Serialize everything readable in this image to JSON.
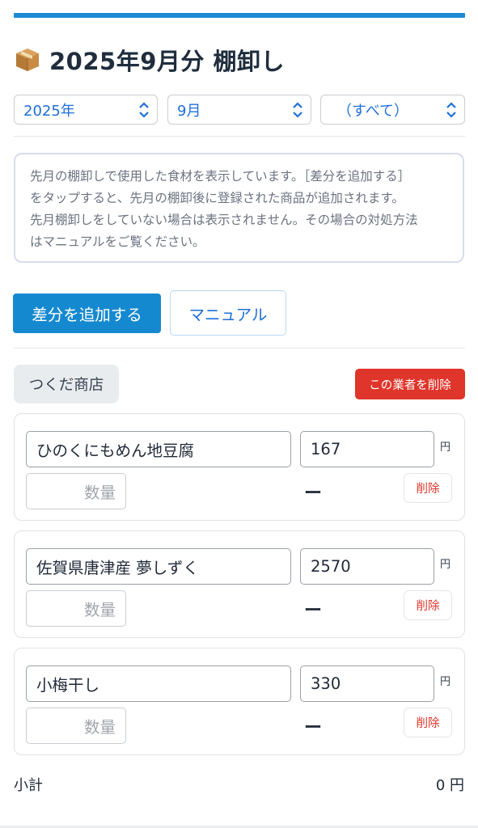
{
  "header": {
    "title": "2025年9月分 棚卸し",
    "icon": "package-box-icon"
  },
  "filters": {
    "year": "2025年",
    "month": "9月",
    "category": "（すべて）"
  },
  "notice": {
    "line1": "先月の棚卸しで使用した食材を表示しています。［差分を追加する］",
    "line2": "をタップすると、先月の棚卸後に登録された商品が追加されます。",
    "line3": "先月棚卸しをしていない場合は表示されません。その場合の対処方法",
    "line4": "はマニュアルをご覧ください。"
  },
  "actions": {
    "add_diff_label": "差分を追加する",
    "manual_label": "マニュアル"
  },
  "vendor": {
    "name": "つくだ商店",
    "delete_label": "この業者を削除"
  },
  "items": [
    {
      "name": "ひのくにもめん地豆腐",
      "price": "167",
      "unit": "円",
      "qty_placeholder": "数量",
      "total": "ー",
      "delete_label": "削除"
    },
    {
      "name": "佐賀県唐津産 夢しずく",
      "price": "2570",
      "unit": "円",
      "qty_placeholder": "数量",
      "total": "ー",
      "delete_label": "削除"
    },
    {
      "name": "小梅干し",
      "price": "330",
      "unit": "円",
      "qty_placeholder": "数量",
      "total": "ー",
      "delete_label": "削除"
    }
  ],
  "subtotal": {
    "label": "小計",
    "value": "0 円"
  },
  "colors": {
    "accent": "#1589cf",
    "danger": "#e0352b",
    "link": "#1e6fd9"
  }
}
